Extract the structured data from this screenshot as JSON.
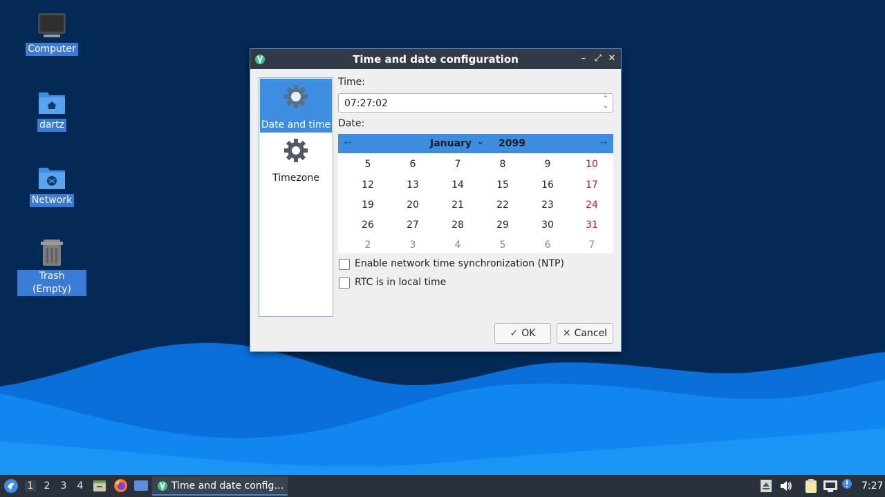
{
  "desktop": {
    "icons": [
      {
        "label": "Computer"
      },
      {
        "label": "dartz"
      },
      {
        "label": "Network"
      },
      {
        "label": "Trash (Empty)"
      }
    ]
  },
  "dialog": {
    "title": "Time and date configuration",
    "sidebar": [
      {
        "label": "Date and time",
        "active": true
      },
      {
        "label": "Timezone",
        "active": false
      }
    ],
    "time_label": "Time:",
    "time_value": "07:27:02",
    "date_label": "Date:",
    "calendar": {
      "month": "January",
      "year": "2099",
      "weeks": [
        [
          "5",
          "6",
          "7",
          "8",
          "9",
          "10"
        ],
        [
          "12",
          "13",
          "14",
          "15",
          "16",
          "17"
        ],
        [
          "19",
          "20",
          "21",
          "22",
          "23",
          "24"
        ],
        [
          "26",
          "27",
          "28",
          "29",
          "30",
          "31"
        ],
        [
          "2",
          "3",
          "4",
          "5",
          "6",
          "7"
        ]
      ]
    },
    "ntp_label": "Enable network time synchronization (NTP)",
    "ntp_checked": false,
    "rtc_label": "RTC is in local time",
    "rtc_checked": false,
    "ok_label": "OK",
    "cancel_label": "Cancel"
  },
  "taskbar": {
    "workspaces": [
      "1",
      "2",
      "3",
      "4"
    ],
    "active_workspace": "1",
    "task_title": "Time and date config…",
    "clock": "7:27"
  },
  "colors": {
    "accent": "#3d8ee0",
    "weekend": "#d0161e",
    "titlebar": "#323a45",
    "desktop_bg": "#022a55"
  }
}
